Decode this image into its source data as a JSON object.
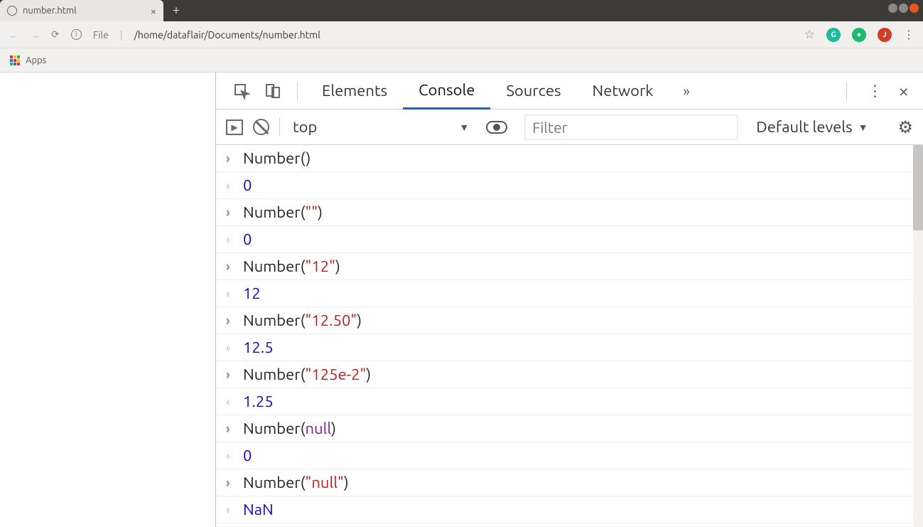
{
  "window": {
    "tab_title": "number.html",
    "new_tab_icon": "+"
  },
  "addr": {
    "file_label": "File",
    "path": "/home/dataflair/Documents/number.html"
  },
  "bookmarks": {
    "apps_label": "Apps"
  },
  "extensions": {
    "g": "G",
    "j": "J"
  },
  "devtools": {
    "tabs": {
      "elements": "Elements",
      "console": "Console",
      "sources": "Sources",
      "network": "Network"
    },
    "toolbar": {
      "context": "top",
      "filter_placeholder": "Filter",
      "levels": "Default levels"
    },
    "rows": [
      {
        "type": "in",
        "parts": [
          {
            "k": "fn",
            "t": "Number"
          },
          {
            "k": "paren",
            "t": "()"
          }
        ]
      },
      {
        "type": "ret",
        "parts": [
          {
            "k": "num",
            "t": "0"
          }
        ]
      },
      {
        "type": "in",
        "parts": [
          {
            "k": "fn",
            "t": "Number"
          },
          {
            "k": "paren",
            "t": "("
          },
          {
            "k": "str",
            "t": "\"\""
          },
          {
            "k": "paren",
            "t": ")"
          }
        ]
      },
      {
        "type": "ret",
        "parts": [
          {
            "k": "num",
            "t": "0"
          }
        ]
      },
      {
        "type": "in",
        "parts": [
          {
            "k": "fn",
            "t": "Number"
          },
          {
            "k": "paren",
            "t": "("
          },
          {
            "k": "str",
            "t": "\"12\""
          },
          {
            "k": "paren",
            "t": ")"
          }
        ]
      },
      {
        "type": "ret",
        "parts": [
          {
            "k": "num",
            "t": "12"
          }
        ]
      },
      {
        "type": "in",
        "parts": [
          {
            "k": "fn",
            "t": "Number"
          },
          {
            "k": "paren",
            "t": "("
          },
          {
            "k": "str",
            "t": "\"12.50\""
          },
          {
            "k": "paren",
            "t": ")"
          }
        ]
      },
      {
        "type": "ret",
        "parts": [
          {
            "k": "num",
            "t": "12.5"
          }
        ]
      },
      {
        "type": "in",
        "parts": [
          {
            "k": "fn",
            "t": "Number"
          },
          {
            "k": "paren",
            "t": "("
          },
          {
            "k": "str",
            "t": "\"125e-2\""
          },
          {
            "k": "paren",
            "t": ")"
          }
        ]
      },
      {
        "type": "ret",
        "parts": [
          {
            "k": "num",
            "t": "1.25"
          }
        ]
      },
      {
        "type": "in",
        "parts": [
          {
            "k": "fn",
            "t": "Number"
          },
          {
            "k": "paren",
            "t": "("
          },
          {
            "k": "nullk",
            "t": "null"
          },
          {
            "k": "paren",
            "t": ")"
          }
        ]
      },
      {
        "type": "ret",
        "parts": [
          {
            "k": "num",
            "t": "0"
          }
        ]
      },
      {
        "type": "in",
        "parts": [
          {
            "k": "fn",
            "t": "Number"
          },
          {
            "k": "paren",
            "t": "("
          },
          {
            "k": "str",
            "t": "\"null\""
          },
          {
            "k": "paren",
            "t": ")"
          }
        ]
      },
      {
        "type": "ret",
        "parts": [
          {
            "k": "kwd",
            "t": "NaN"
          }
        ]
      }
    ]
  }
}
